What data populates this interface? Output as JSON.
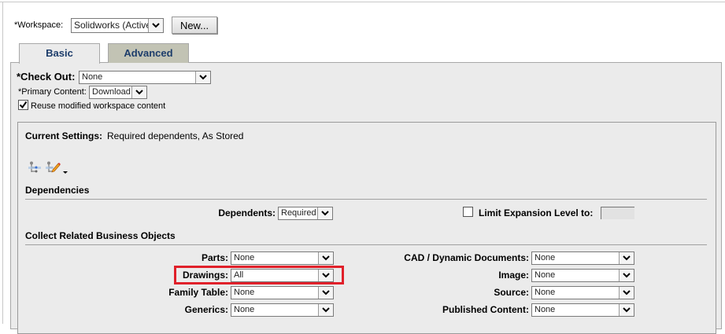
{
  "workspace": {
    "label": "*Workspace:",
    "value": "Solidworks (Active)",
    "new_button": "New..."
  },
  "tabs": [
    {
      "label": "Basic",
      "active": true
    },
    {
      "label": "Advanced",
      "active": false
    }
  ],
  "checkout": {
    "label": "*Check Out:",
    "value": "None"
  },
  "primary_content": {
    "label": "*Primary Content:",
    "value": "Download"
  },
  "reuse": {
    "label": "Reuse modified workspace content",
    "checked": true
  },
  "current_settings": {
    "label": "Current Settings:",
    "value": "Required dependents, As Stored"
  },
  "dependencies": {
    "header": "Dependencies",
    "dependents_label": "Dependents:",
    "dependents_value": "Required",
    "limit_label": "Limit Expansion Level to:",
    "limit_checked": false,
    "limit_value": ""
  },
  "collect": {
    "header": "Collect Related Business Objects",
    "left": [
      {
        "label": "Parts:",
        "value": "None"
      },
      {
        "label": "Drawings:",
        "value": "All"
      },
      {
        "label": "Family Table:",
        "value": "None"
      },
      {
        "label": "Generics:",
        "value": "None"
      }
    ],
    "right": [
      {
        "label": "CAD / Dynamic Documents:",
        "value": "None"
      },
      {
        "label": "Image:",
        "value": "None"
      },
      {
        "label": "Source:",
        "value": "None"
      },
      {
        "label": "Published Content:",
        "value": "None"
      }
    ]
  },
  "highlight_color": "#e0202a"
}
